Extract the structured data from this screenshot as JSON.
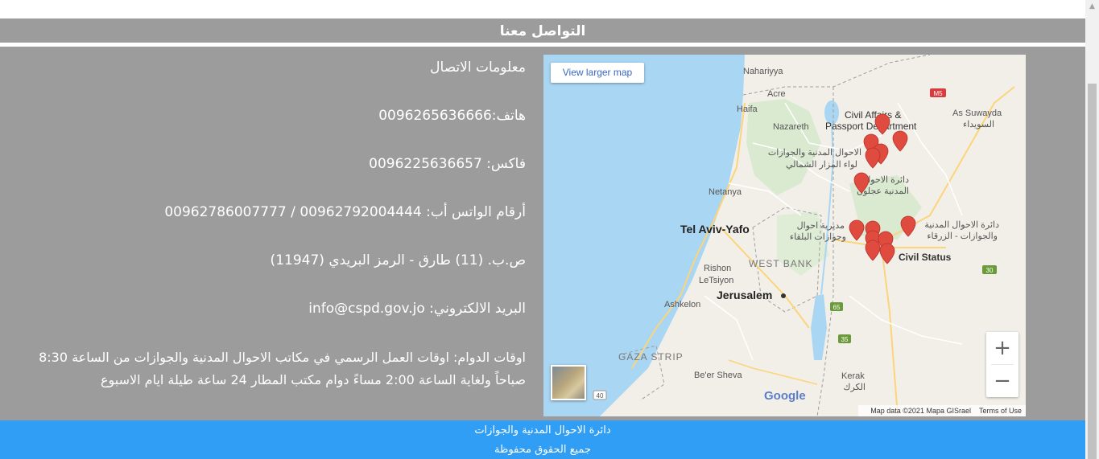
{
  "section": {
    "title": "التواصل معنا"
  },
  "contact": {
    "heading": "معلومات الاتصال",
    "phone": "هاتف:0096265636666",
    "fax": "فاكس: 0096225636657",
    "whatsapp": "أرقام الواتس أب: 00962792004444 / 00962786007777",
    "pobox": "ص.ب. (11) طارق - الرمز البريدي (11947)",
    "email": "البريد الالكتروني: info@cspd.gov.jo",
    "hours": "اوقات الدوام: اوقات العمل الرسمي في مكاتب الاحوال المدنية والجوازات من الساعة 8:30 صباحاً ولغاية الساعة 2:00 مساءً دوام مكتب المطار 24 ساعة طيلة ايام الاسبوع"
  },
  "map": {
    "larger_map_label": "View larger map",
    "zoom_in": "+",
    "zoom_out": "−",
    "google_logo": "Google",
    "attribution": "Map data ©2021 Mapa GISrael",
    "terms": "Terms of Use",
    "labels": {
      "nahariyya": "Nahariyya",
      "acre": "Acre",
      "haifa": "Haifa",
      "nazareth": "Nazareth",
      "netanya": "Netanya",
      "tel_aviv": "Tel Aviv-Yafo",
      "rishon": "Rishon",
      "letsiyon": "LeTsiyon",
      "west_bank": "WEST BANK",
      "jerusalem": "Jerusalem",
      "ashkelon": "Ashkelon",
      "gaza": "GAZA STRIP",
      "beersheva": "Be'er Sheva",
      "kerak": "Kerak",
      "kerak_ar": "الكرك",
      "as_suwayda": "As Suwayda",
      "as_suwayda_ar": "السويداء",
      "civil_affairs_1": "Civil Affairs &",
      "civil_affairs_2": "Passport Department",
      "north_mazar_1": "الاحوال المدنية والجوازات",
      "north_mazar_2": "لواء المزار الشمالي",
      "ajloun_1": "دائرة الاحوال",
      "ajloun_2": "المدنية عجلون",
      "balqa_1": "مديرية احوال",
      "balqa_2": "وجوازات البلقاء",
      "zarqa_1": "دائرة الاحوال المدنية",
      "zarqa_2": "والجوازات - الزرقاء",
      "civil_status": "Civil Status",
      "road_m5": "M5",
      "road_30": "30",
      "road_65": "65",
      "road_35": "35",
      "road_40": "40"
    }
  },
  "footer": {
    "line1": "دائرة الاحوال المدنية والجوازات",
    "line2": "جميع الحقوق محفوظة"
  }
}
